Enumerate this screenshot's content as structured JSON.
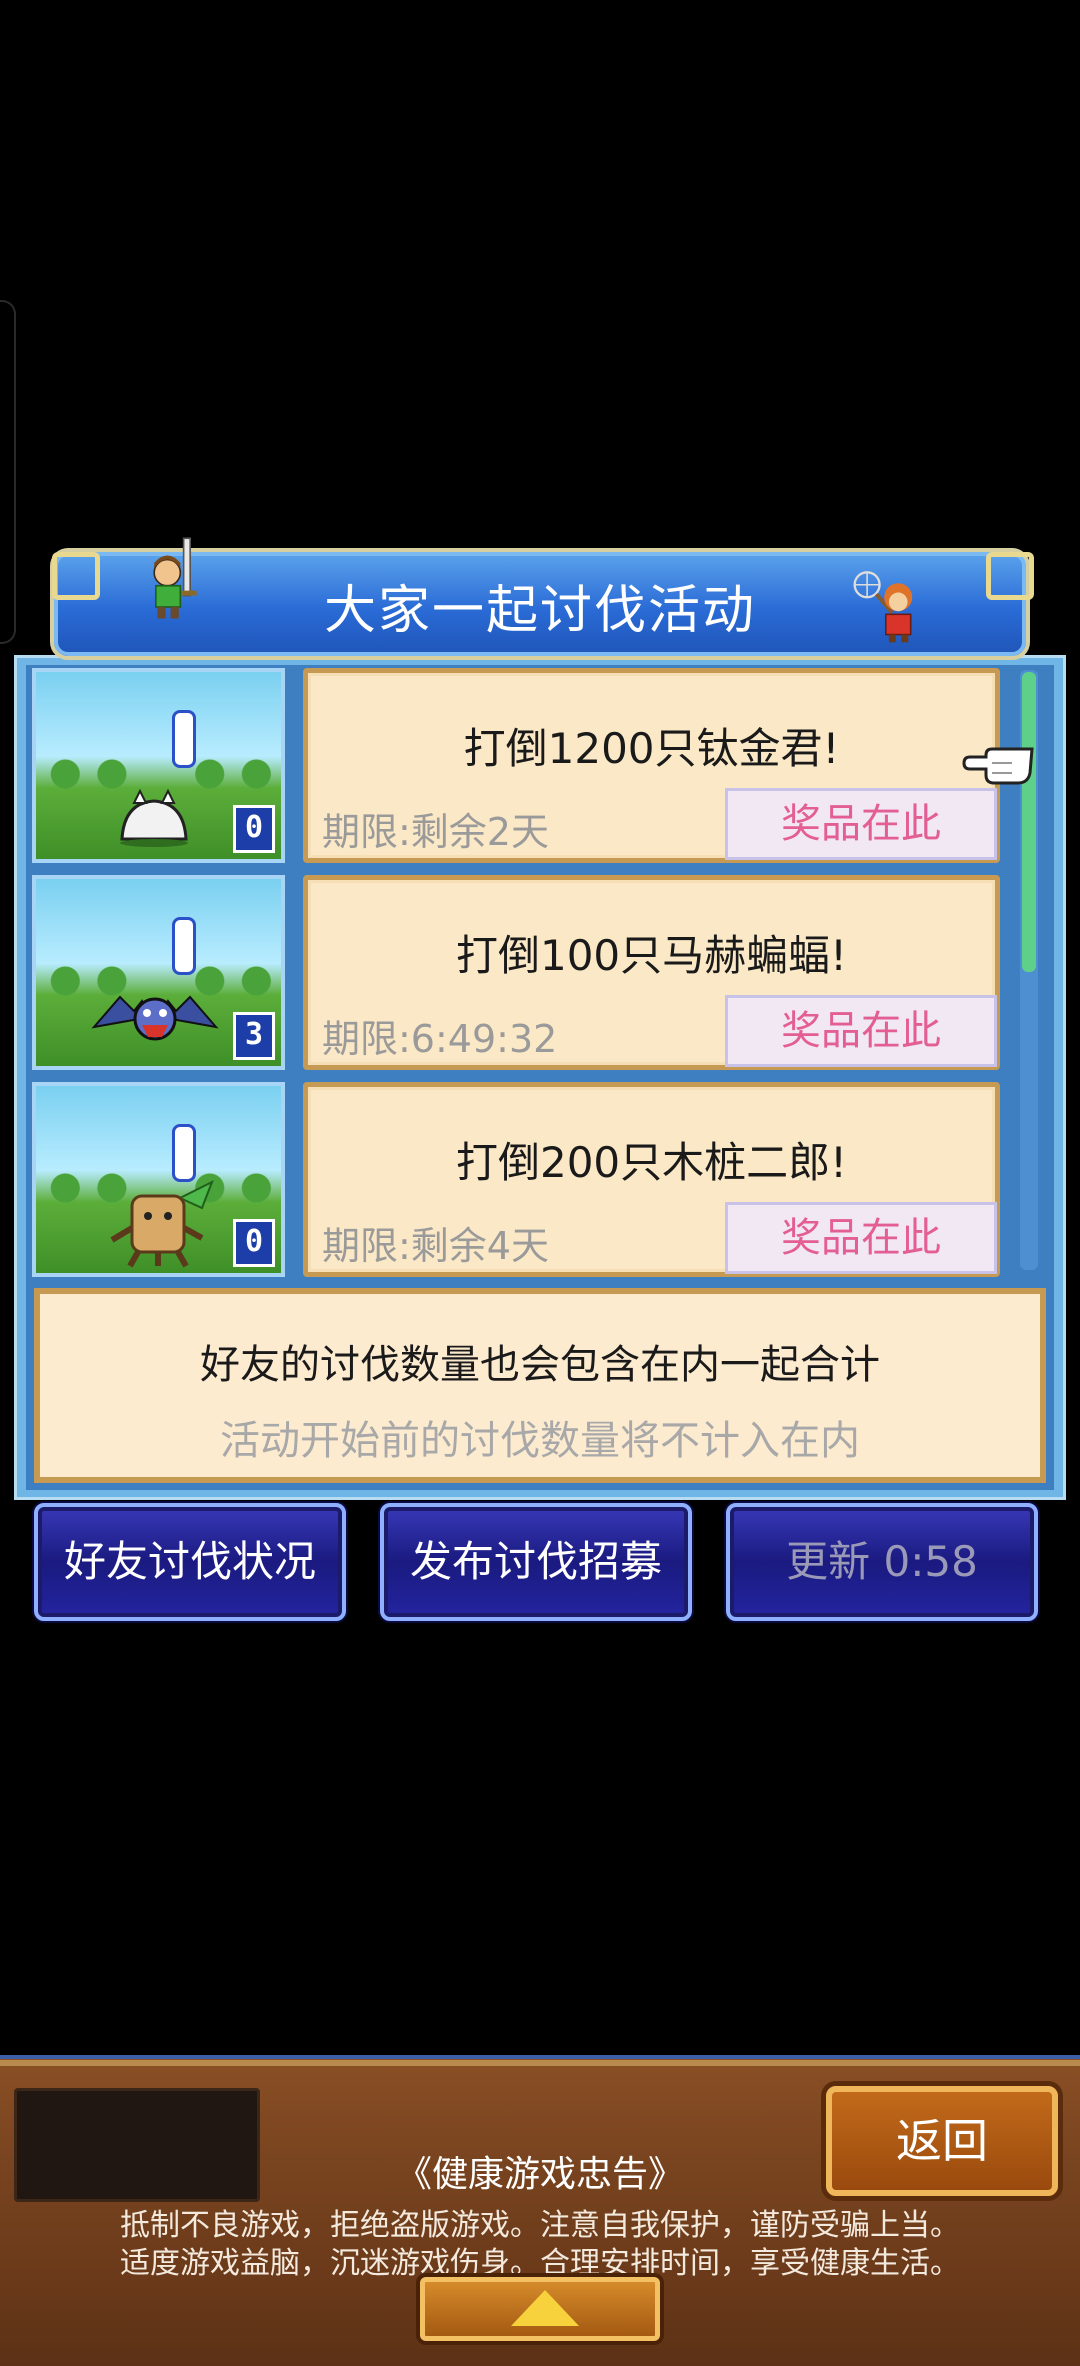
{
  "banner": {
    "title": "大家一起讨伐活动"
  },
  "quests": [
    {
      "title": "打倒1200只钛金君!",
      "deadline": "期限:剩余2天",
      "prize_label": "奖品在此",
      "count": "0",
      "monster_icon": "white-slime-icon"
    },
    {
      "title": "打倒100只马赫蝙蝠!",
      "deadline": "期限:6:49:32",
      "prize_label": "奖品在此",
      "count": "3",
      "monster_icon": "bat-icon"
    },
    {
      "title": "打倒200只木桩二郎!",
      "deadline": "期限:剩余4天",
      "prize_label": "奖品在此",
      "count": "0",
      "monster_icon": "tree-stump-icon"
    }
  ],
  "info": {
    "line1": "好友的讨伐数量也会包含在内一起合计",
    "line2": "活动开始前的讨伐数量将不计入在内"
  },
  "buttons": {
    "friend_status": "好友讨伐状况",
    "post_recruit": "发布讨伐招募",
    "refresh": "更新 0:58"
  },
  "footer": {
    "back": "返回",
    "notice_title": "《健康游戏忠告》",
    "notice_line1": "抵制不良游戏，拒绝盗版游戏。注意自我保护，谨防受骗上当。",
    "notice_line2": "适度游戏益脑，沉迷游戏伤身。合理安排时间，享受健康生活。"
  },
  "colors": {
    "prize_text": "#e35e93",
    "panel_blue": "#3d7fc0",
    "card_bg": "#fbe8c6"
  }
}
